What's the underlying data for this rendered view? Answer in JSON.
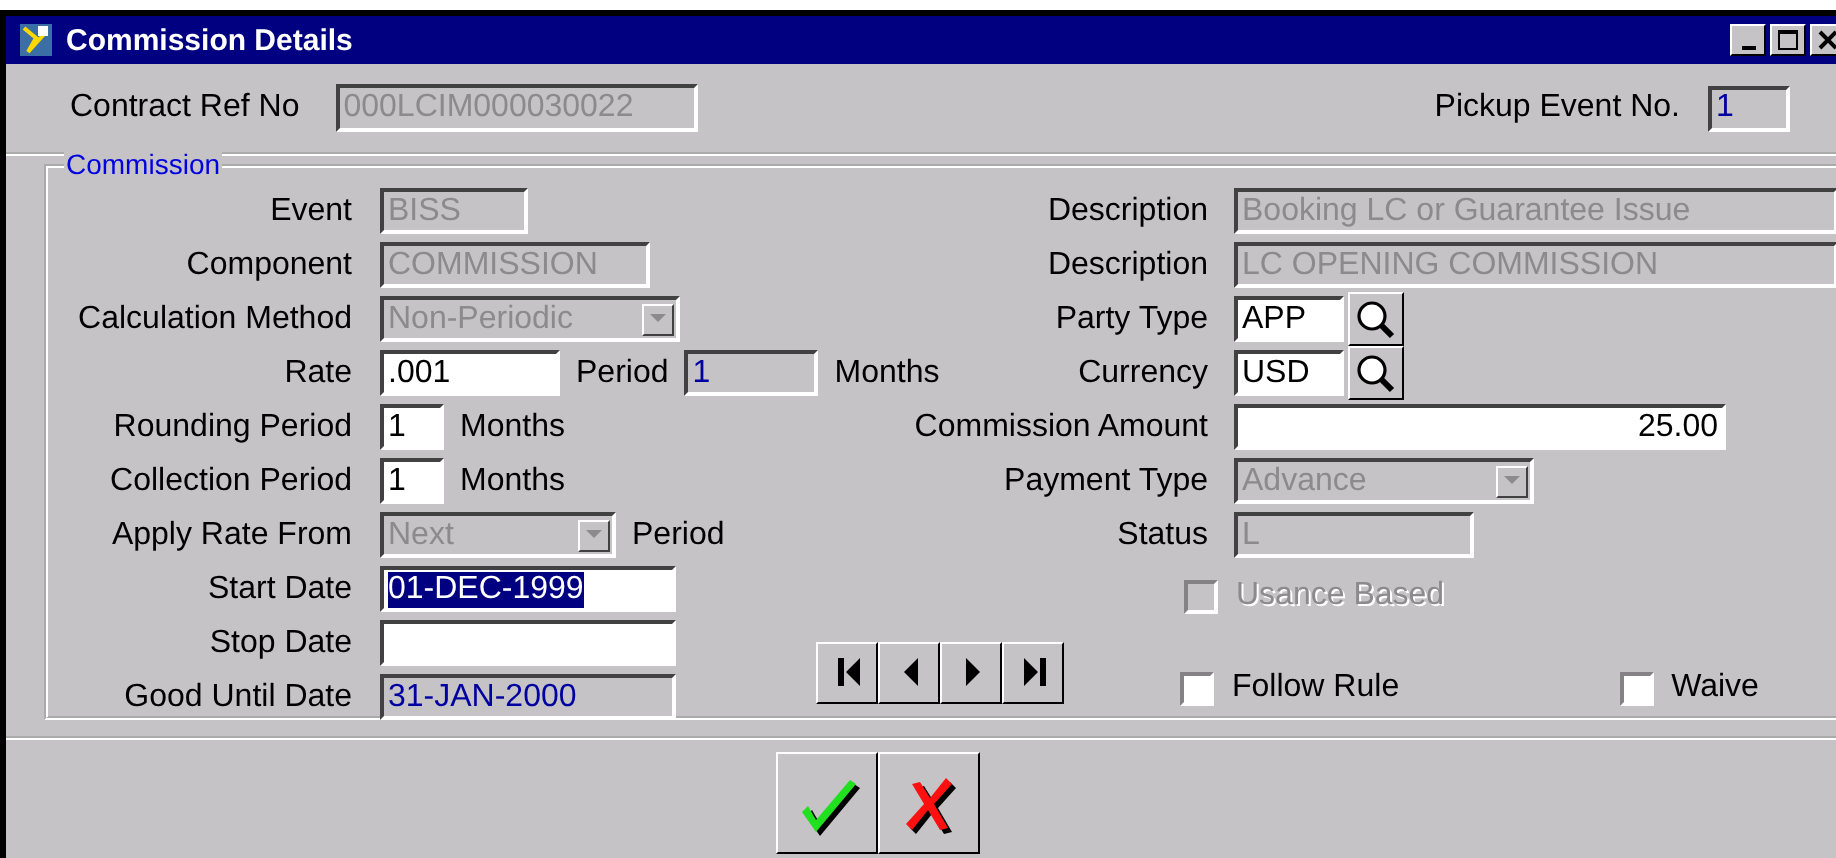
{
  "window": {
    "title": "Commission Details"
  },
  "header": {
    "contract_ref": {
      "label": "Contract Ref No",
      "value": "000LCIM000030022",
      "disabled": true
    },
    "pickup_event": {
      "label": "Pickup Event No.",
      "value": "1"
    }
  },
  "commission": {
    "legend": "Commission",
    "left_rows": [
      {
        "label": "Event",
        "items": [
          {
            "kind": "input",
            "value": "BISS",
            "disabled": true
          }
        ]
      },
      {
        "label": "Component",
        "items": [
          {
            "kind": "input",
            "value": "COMMISSION",
            "disabled": true
          }
        ]
      },
      {
        "label": "Calculation Method",
        "items": [
          {
            "kind": "select",
            "value": "Non-Periodic",
            "disabled": true
          }
        ]
      },
      {
        "label": "Rate",
        "items": [
          {
            "kind": "input",
            "value": ".001",
            "disabled": false
          },
          {
            "kind": "text",
            "text": "Period"
          },
          {
            "kind": "output",
            "value": "1"
          },
          {
            "kind": "text",
            "text": "Months"
          }
        ]
      },
      {
        "label": "Rounding Period",
        "items": [
          {
            "kind": "input",
            "value": "1",
            "disabled": false
          },
          {
            "kind": "text",
            "text": "Months"
          }
        ]
      },
      {
        "label": "Collection Period",
        "items": [
          {
            "kind": "input",
            "value": "1",
            "disabled": false
          },
          {
            "kind": "text",
            "text": "Months"
          }
        ]
      },
      {
        "label": "Apply Rate From",
        "items": [
          {
            "kind": "select",
            "value": "Next",
            "disabled": true
          },
          {
            "kind": "text",
            "text": "Period"
          }
        ]
      },
      {
        "label": "Start Date",
        "items": [
          {
            "kind": "input",
            "value": "01-DEC-1999",
            "disabled": false,
            "selected": true
          }
        ]
      },
      {
        "label": "Stop Date",
        "items": [
          {
            "kind": "input",
            "value": "",
            "disabled": false
          }
        ]
      },
      {
        "label": "Good Until Date",
        "items": [
          {
            "kind": "output",
            "value": "31-JAN-2000"
          }
        ]
      }
    ],
    "right_rows": [
      {
        "label": "Description",
        "items": [
          {
            "kind": "input",
            "value": "Booking LC or Guarantee Issue",
            "disabled": true
          }
        ]
      },
      {
        "label": "Description",
        "items": [
          {
            "kind": "input",
            "value": "LC OPENING COMMISSION",
            "disabled": true
          }
        ]
      },
      {
        "label": "Party Type",
        "items": [
          {
            "kind": "input",
            "value": "APP",
            "disabled": false
          },
          {
            "kind": "lookup"
          }
        ]
      },
      {
        "label": "Currency",
        "items": [
          {
            "kind": "input",
            "value": "USD",
            "disabled": false
          },
          {
            "kind": "lookup"
          }
        ]
      },
      {
        "label": "Commission Amount",
        "items": [
          {
            "kind": "amount",
            "value": "25.00",
            "disabled": false
          }
        ]
      },
      {
        "label": "Payment Type",
        "items": [
          {
            "kind": "select",
            "value": "Advance",
            "disabled": true
          }
        ]
      },
      {
        "label": "Status",
        "items": [
          {
            "kind": "input",
            "value": "L",
            "disabled": true
          }
        ]
      }
    ],
    "checkboxes": [
      {
        "label": "Usance Based",
        "checked": false,
        "disabled": true
      },
      {
        "label": "Follow Rule",
        "checked": false,
        "disabled": false
      },
      {
        "label": "Waive",
        "checked": false,
        "disabled": false
      }
    ]
  }
}
